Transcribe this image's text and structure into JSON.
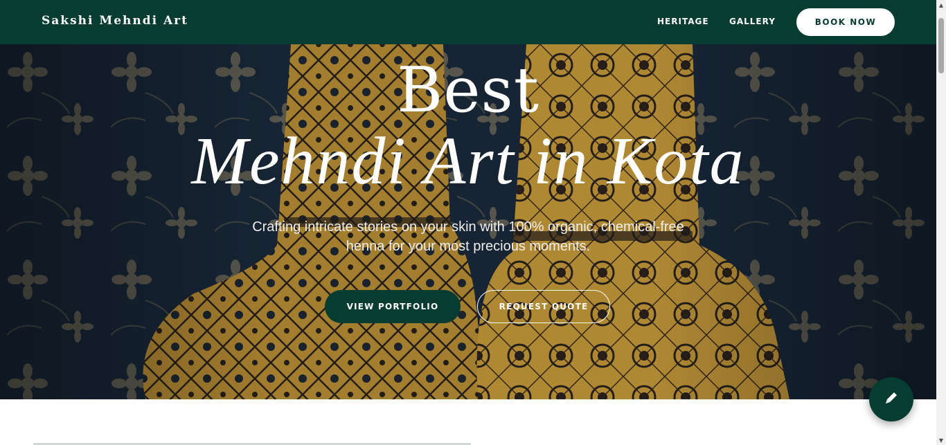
{
  "header": {
    "brand": "Sakshi Mehndi Art",
    "nav": {
      "heritage": "HERITAGE",
      "gallery": "GALLERY"
    },
    "book_button": "BOOK NOW"
  },
  "hero": {
    "title_line1": "Best",
    "title_line2": "Mehndi Art in Kota",
    "subtitle": "Crafting intricate stories on your skin with 100% organic, chemical-free henna for your most precious moments.",
    "primary_button": "VIEW PORTFOLIO",
    "secondary_button": "REQUEST QUOTE"
  },
  "fab": {
    "icon": "pencil-icon"
  },
  "colors": {
    "brand_green": "#073d31",
    "white": "#ffffff"
  }
}
